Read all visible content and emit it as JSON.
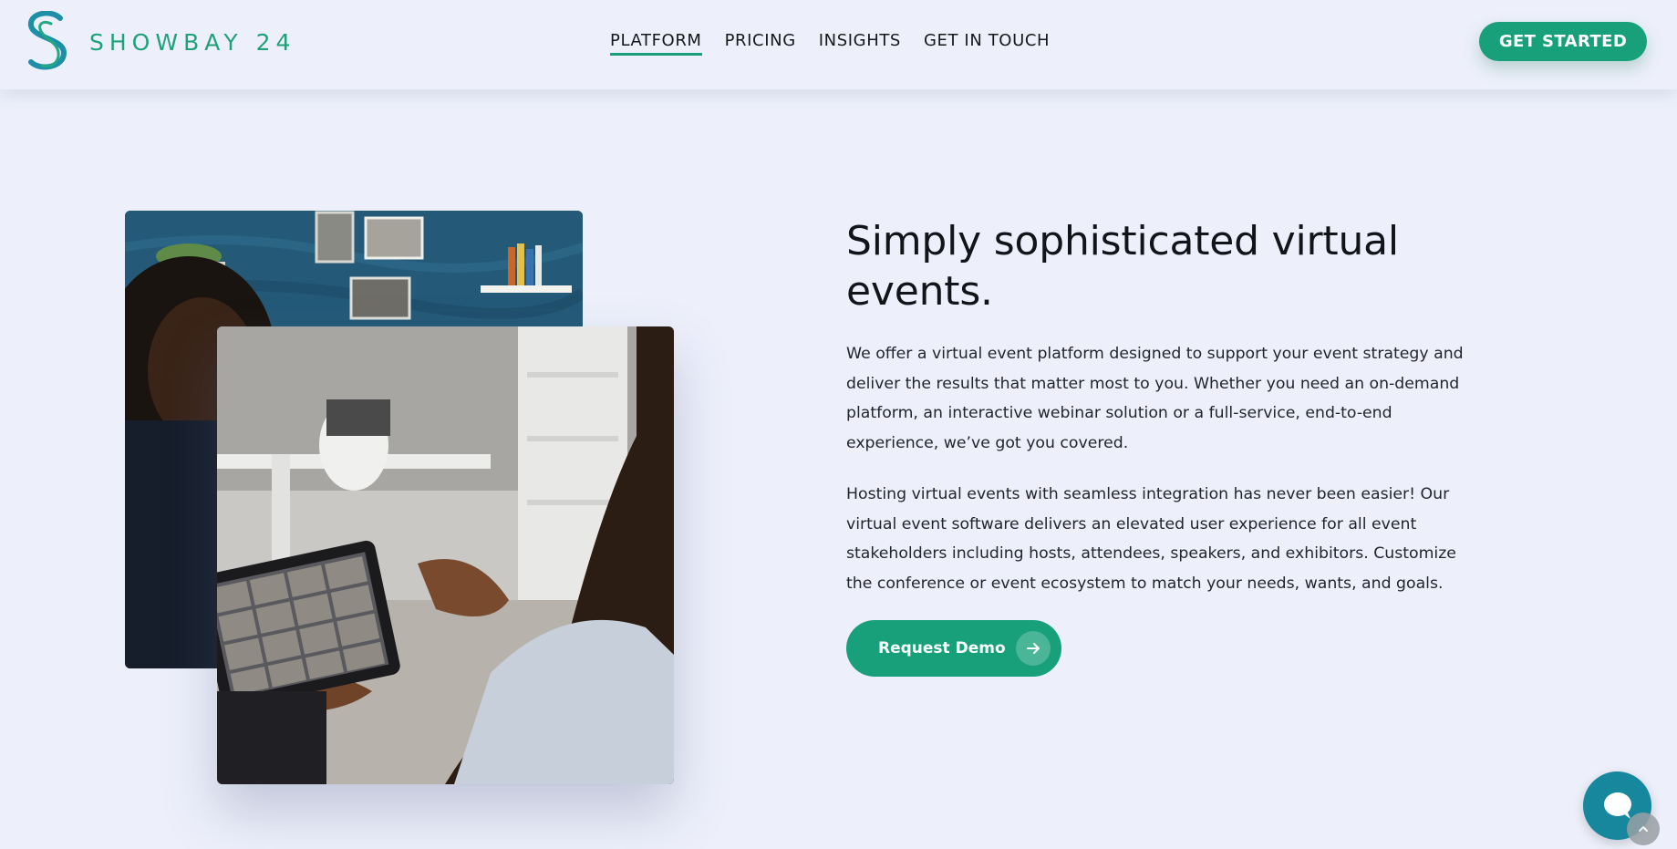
{
  "brand": {
    "name": "SHOWBAY 24",
    "primary_color": "#18a07a",
    "accent_color": "#1e8fa8",
    "background": "#edf0fb"
  },
  "nav": {
    "items": [
      {
        "label": "PLATFORM",
        "active": true
      },
      {
        "label": "PRICING",
        "active": false
      },
      {
        "label": "INSIGHTS",
        "active": false
      },
      {
        "label": "GET IN TOUCH",
        "active": false
      }
    ],
    "cta_label": "GET STARTED"
  },
  "hero": {
    "headline": "Simply sophisticated virtual events.",
    "paragraphs": [
      "We offer a virtual event platform designed to support your event strategy and deliver the results that matter most to you. Whether you need an on-demand platform, an interactive webinar solution or a full-service, end-to-end experience, we’ve got you covered.",
      "Hosting virtual events with seamless integration has never been easier! Our virtual event software delivers an elevated user experience for all event stakeholders including hosts, attendees, speakers, and exhibitors. Customize the conference or event ecosystem to match your needs, wants, and goals."
    ],
    "button_label": "Request Demo",
    "button_icon": "arrow-right-icon"
  },
  "widgets": {
    "chat_icon": "chat-bubble-icon",
    "scroll_icon": "chevron-up-icon"
  }
}
